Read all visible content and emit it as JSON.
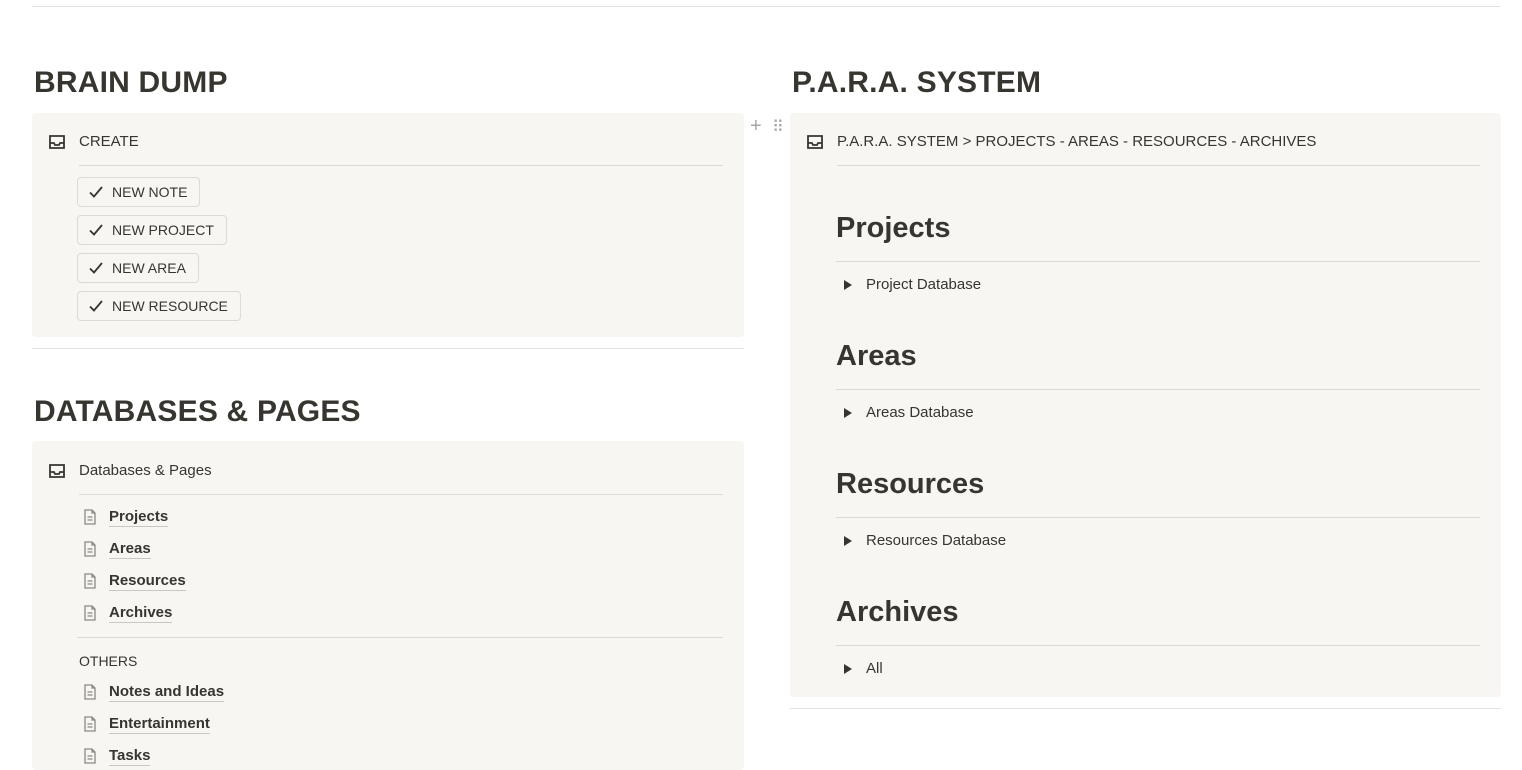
{
  "brain_dump": {
    "heading": "BRAIN DUMP",
    "callout_title": "CREATE",
    "buttons": [
      "NEW NOTE",
      "NEW PROJECT",
      "NEW AREA",
      "NEW RESOURCE"
    ]
  },
  "databases": {
    "heading": "DATABASES & PAGES",
    "callout_title": "Databases & Pages",
    "pages": [
      "Projects",
      "Areas",
      "Resources",
      "Archives"
    ],
    "others_label": "OTHERS",
    "other_pages": [
      "Notes and Ideas",
      "Entertainment",
      "Tasks"
    ]
  },
  "para": {
    "heading": "P.A.R.A. SYSTEM",
    "callout_title": "P.A.R.A. SYSTEM > PROJECTS - AREAS - RESOURCES - ARCHIVES",
    "sections": [
      {
        "title": "Projects",
        "toggle": "Project Database"
      },
      {
        "title": "Areas",
        "toggle": "Areas Database"
      },
      {
        "title": "Resources",
        "toggle": "Resources Database"
      },
      {
        "title": "Archives",
        "toggle": "All"
      }
    ]
  },
  "block_controls": {
    "add": "+",
    "drag": "⠿"
  }
}
